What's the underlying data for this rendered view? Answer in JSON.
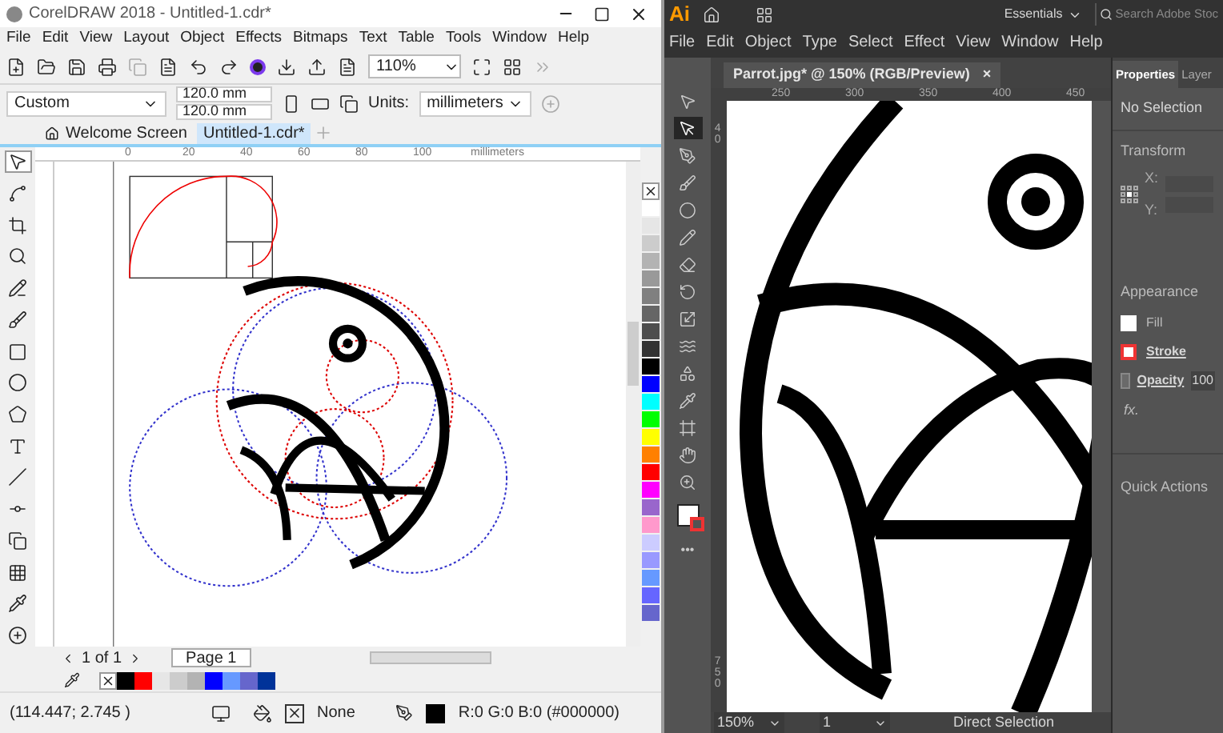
{
  "corel": {
    "title": "CorelDRAW 2018 - Untitled-1.cdr*",
    "menu": [
      "File",
      "Edit",
      "View",
      "Layout",
      "Object",
      "Effects",
      "Bitmaps",
      "Text",
      "Table",
      "Tools",
      "Window",
      "Help"
    ],
    "toolbar": {
      "zoom": "110%"
    },
    "property_bar": {
      "preset": "Custom",
      "width": "120.0 mm",
      "height": "120.0 mm",
      "units_label": "Units:",
      "units": "millimeters"
    },
    "tabs": [
      {
        "label": "Welcome Screen",
        "kind": "home",
        "selected": false
      },
      {
        "label": "Untitled-1.cdr*",
        "kind": "document",
        "selected": true
      }
    ],
    "ruler": {
      "ticks": [
        "0",
        "20",
        "40",
        "60",
        "80",
        "100"
      ],
      "unit": "millimeters"
    },
    "tools": [
      {
        "kind": "pick",
        "selected": true
      },
      {
        "kind": "shape",
        "selected": false
      },
      {
        "kind": "crop",
        "selected": false
      },
      {
        "kind": "zoom",
        "selected": false
      },
      {
        "kind": "freehand",
        "selected": false
      },
      {
        "kind": "artistic",
        "selected": false
      },
      {
        "kind": "rectangle",
        "selected": false
      },
      {
        "kind": "ellipse",
        "selected": false
      },
      {
        "kind": "polygon",
        "selected": false
      },
      {
        "kind": "text",
        "selected": false
      },
      {
        "kind": "line",
        "selected": false
      },
      {
        "kind": "connector",
        "selected": false
      },
      {
        "kind": "shadow",
        "selected": false
      },
      {
        "kind": "transparency",
        "selected": false
      },
      {
        "kind": "eyedropper",
        "selected": false
      },
      {
        "kind": "add",
        "selected": false
      }
    ],
    "palette": [
      {
        "color": "#ffffff"
      },
      {
        "color": "#e6e6e6"
      },
      {
        "color": "#cccccc"
      },
      {
        "color": "#b3b3b3"
      },
      {
        "color": "#999999"
      },
      {
        "color": "#808080"
      },
      {
        "color": "#666666"
      },
      {
        "color": "#4d4d4d"
      },
      {
        "color": "#333333"
      },
      {
        "color": "#000000"
      },
      {
        "color": "#0000ff"
      },
      {
        "color": "#00ffff"
      },
      {
        "color": "#00ff00"
      },
      {
        "color": "#ffff00"
      },
      {
        "color": "#ff8000"
      },
      {
        "color": "#ff0000"
      },
      {
        "color": "#ff00ff"
      },
      {
        "color": "#9966cc"
      },
      {
        "color": "#ff99cc"
      },
      {
        "color": "#ccccff"
      },
      {
        "color": "#9999ff"
      },
      {
        "color": "#6699ff"
      },
      {
        "color": "#6666ff"
      },
      {
        "color": "#6666cc"
      }
    ],
    "page_nav": {
      "count": "1 of 1",
      "page": "Page 1"
    },
    "document_palette": [
      {
        "color": "#000000"
      },
      {
        "color": "#ff0000"
      },
      {
        "color": "#e6e6e6"
      },
      {
        "color": "#cccccc"
      },
      {
        "color": "#b3b3b3"
      },
      {
        "color": "#0000ff"
      },
      {
        "color": "#6699ff"
      },
      {
        "color": "#6666cc"
      },
      {
        "color": "#003399"
      }
    ],
    "status": {
      "coords": "(114.447; 2.745 )",
      "fill": "None",
      "outline": "R:0 G:0 B:0 (#000000)"
    }
  },
  "illustrator": {
    "logo": "Ai",
    "workspace": "Essentials",
    "search": {
      "placeholder": "Search Adobe Stoc"
    },
    "menu": [
      "File",
      "Edit",
      "Object",
      "Type",
      "Select",
      "Effect",
      "View",
      "Window",
      "Help"
    ],
    "document_tab": {
      "label": "Parrot.jpg* @ 150% (RGB/Preview)",
      "close": "×"
    },
    "ruler": {
      "ticks": [
        "250",
        "300",
        "350",
        "400",
        "450"
      ],
      "vertical_ticks": [
        "40",
        "750"
      ]
    },
    "tools": [
      {
        "kind": "selection",
        "selected": false
      },
      {
        "kind": "direct",
        "selected": true
      },
      {
        "kind": "pen",
        "selected": false
      },
      {
        "kind": "brush",
        "selected": false
      },
      {
        "kind": "ellipse",
        "selected": false
      },
      {
        "kind": "pencil",
        "selected": false
      },
      {
        "kind": "eraser",
        "selected": false
      },
      {
        "kind": "rotate",
        "selected": false
      },
      {
        "kind": "scale",
        "selected": false
      },
      {
        "kind": "warp",
        "selected": false
      },
      {
        "kind": "shapes",
        "selected": false
      },
      {
        "kind": "eyedropper",
        "selected": false
      },
      {
        "kind": "artboard",
        "selected": false
      },
      {
        "kind": "hand",
        "selected": false
      },
      {
        "kind": "zoom",
        "selected": false
      }
    ],
    "more": "•••",
    "panel": {
      "tabs": [
        {
          "label": "Properties",
          "selected": true
        },
        {
          "label": "Layer",
          "selected": false
        }
      ],
      "selection": "No Selection",
      "transform": "Transform",
      "x_label": "X:",
      "y_label": "Y:",
      "appearance": "Appearance",
      "fill": "Fill",
      "stroke": "Stroke",
      "opacity": "Opacity",
      "opacity_value": "100",
      "fx": "fx.",
      "quick_actions": "Quick Actions"
    },
    "status": {
      "zoom": "150%",
      "artboard": "1",
      "tool": "Direct Selection"
    }
  }
}
